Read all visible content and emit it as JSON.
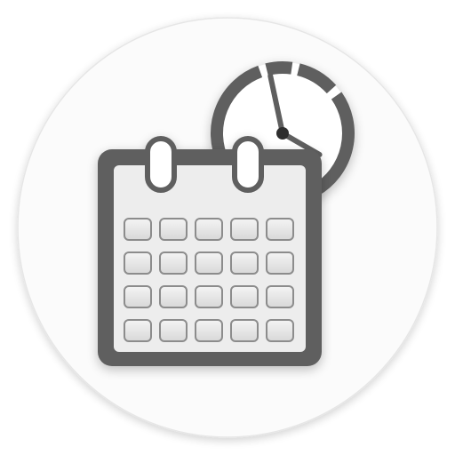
{
  "icon": {
    "name": "calendar-clock-icon",
    "glyphs": [
      "circle-badge",
      "clock-icon",
      "calendar-icon"
    ]
  },
  "calendar": {
    "columns": 5,
    "rows": 4
  },
  "clock": {
    "hour_hand_points_to": 4,
    "minute_hand_points_to": 58
  },
  "colors": {
    "page_background": "#ffffff",
    "badge_fill": "#fbfbfb",
    "badge_edge": "#e6e6e6",
    "frame_dark": "#5f5f5f",
    "frame_mid": "#7a7a7a",
    "calendar_face": "#ededed",
    "cell_fill": "#e4e4e4",
    "cell_edge": "#8c8c8c",
    "ring_fill": "#ffffff",
    "clock_face": "#ffffff"
  }
}
